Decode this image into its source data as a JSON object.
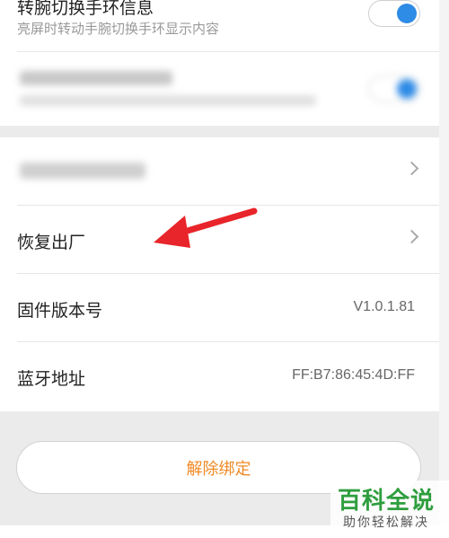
{
  "settings": {
    "wrist_switch": {
      "title": "转腕切换手环信息",
      "subtitle": "亮屏时转动手腕切换手环显示内容",
      "enabled": true
    },
    "hidden_toggle": {
      "title": "",
      "subtitle": "",
      "enabled": true
    },
    "hidden_row": {
      "label": ""
    },
    "factory_reset": {
      "label": "恢复出厂"
    },
    "firmware": {
      "label": "固件版本号",
      "value": "V1.0.1.81"
    },
    "bluetooth": {
      "label": "蓝牙地址",
      "value": "FF:B7:86:45:4D:FF"
    }
  },
  "unbind_button": {
    "label": "解除绑定"
  },
  "watermark": {
    "title": "百科全说",
    "subtitle": "助你轻松解决"
  },
  "colors": {
    "accent_blue": "#2e8be6",
    "unbind_orange": "#f08a24",
    "annotation_red": "#e8252a",
    "watermark_green": "#2e9e3e"
  }
}
